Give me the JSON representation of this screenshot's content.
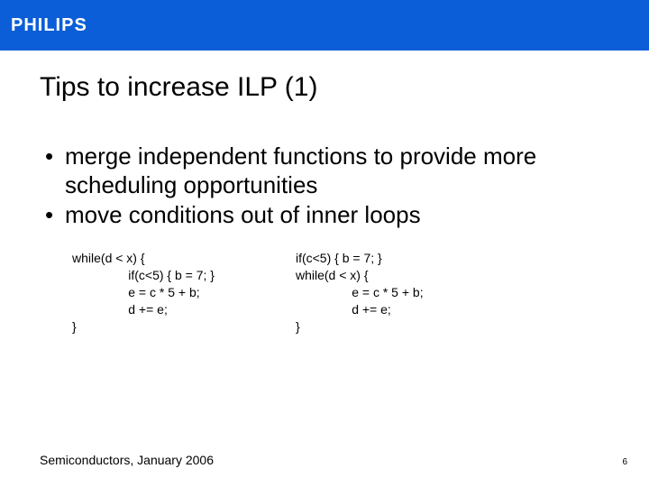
{
  "brand": "PHILIPS",
  "title": "Tips to increase ILP (1)",
  "bullets": [
    "merge independent functions to provide more scheduling opportunities",
    "move conditions out of inner loops"
  ],
  "code": {
    "left": "while(d < x) {\n                if(c<5) { b = 7; }\n                e = c * 5 + b;\n                d += e;\n}",
    "right": "if(c<5) { b = 7; }\nwhile(d < x) {\n                e = c * 5 + b;\n                d += e;\n}"
  },
  "footer": {
    "left": "Semiconductors, January 2006",
    "page": "6"
  }
}
